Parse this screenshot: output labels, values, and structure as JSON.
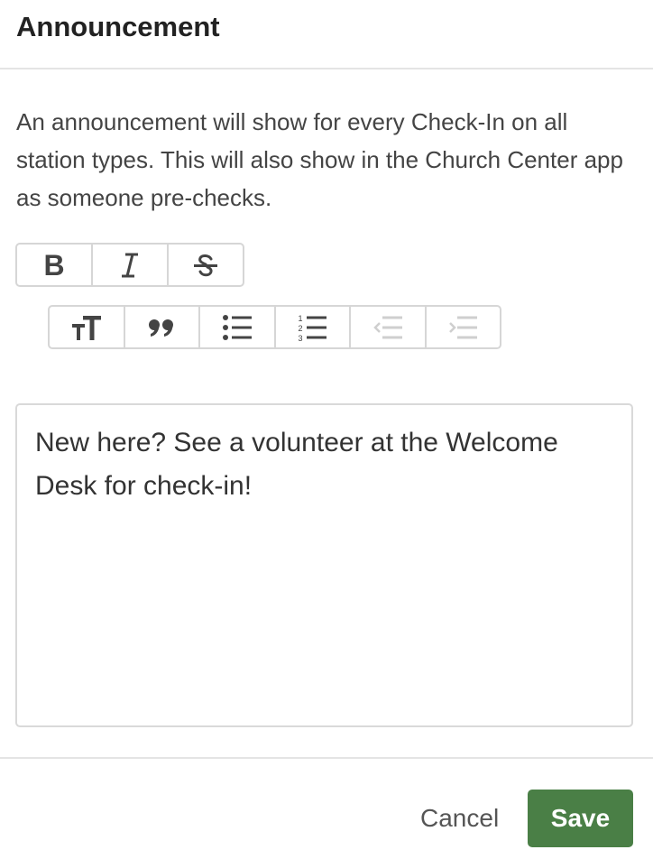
{
  "dialog": {
    "title": "Announcement",
    "description": "An announcement will show for every Check-In on all station types. This will also show in the Church Center app as someone pre-checks."
  },
  "toolbar": {
    "row1": [
      {
        "name": "bold-button",
        "icon": "bold-icon",
        "enabled": true
      },
      {
        "name": "italic-button",
        "icon": "italic-icon",
        "enabled": true
      },
      {
        "name": "strikethrough-button",
        "icon": "strikethrough-icon",
        "enabled": true
      }
    ],
    "row2": [
      {
        "name": "heading-button",
        "icon": "heading-icon",
        "enabled": true
      },
      {
        "name": "quote-button",
        "icon": "quote-icon",
        "enabled": true
      },
      {
        "name": "bullet-list-button",
        "icon": "bullet-list-icon",
        "enabled": true
      },
      {
        "name": "numbered-list-button",
        "icon": "numbered-list-icon",
        "enabled": true
      },
      {
        "name": "outdent-button",
        "icon": "outdent-icon",
        "enabled": false
      },
      {
        "name": "indent-button",
        "icon": "indent-icon",
        "enabled": false
      }
    ]
  },
  "editor": {
    "value": "New here? See a volunteer at the Welcome Desk for check-in!"
  },
  "footer": {
    "cancel_label": "Cancel",
    "save_label": "Save"
  },
  "colors": {
    "primary": "#4a7f46",
    "icon": "#444444",
    "icon_disabled": "#cfcfcf",
    "border": "#d6d6d6"
  }
}
